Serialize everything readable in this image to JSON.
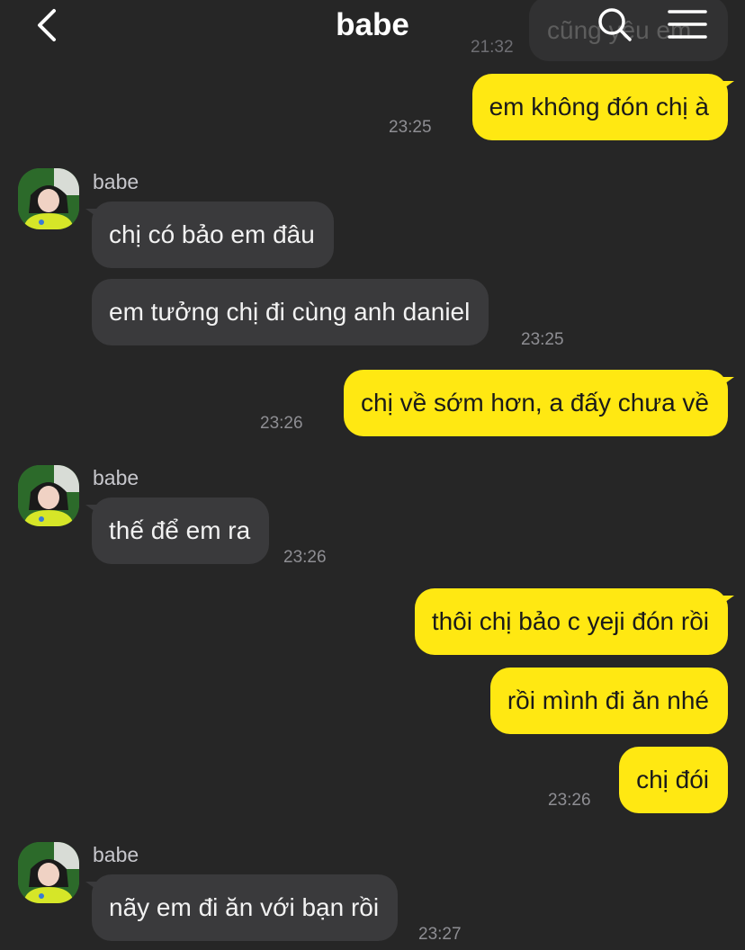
{
  "header": {
    "title": "babe",
    "back_icon": "chevron-left-icon",
    "search_icon": "search-icon",
    "menu_icon": "menu-icon",
    "partial_message": {
      "text": "cũng yêu em",
      "time": "21:32"
    }
  },
  "colors": {
    "background": "#262626",
    "incoming_bubble": "#3a3a3c",
    "outgoing_bubble": "#ffe812",
    "timestamp": "#8e8e93"
  },
  "messages": [
    {
      "side": "out",
      "text": "em không đón chị à",
      "time": "23:25"
    },
    {
      "side": "in",
      "sender": "babe",
      "texts": [
        "chị có bảo em đâu",
        "em tưởng chị đi cùng anh daniel"
      ],
      "time": "23:25"
    },
    {
      "side": "out",
      "text": "chị về sớm hơn, a đấy chưa về",
      "time": "23:26"
    },
    {
      "side": "in",
      "sender": "babe",
      "texts": [
        "thế để em ra"
      ],
      "time": "23:26"
    },
    {
      "side": "out",
      "texts": [
        "thôi chị bảo c yeji đón rồi",
        "rồi mình đi ăn nhé",
        "chị đói"
      ],
      "time": "23:26"
    },
    {
      "side": "in",
      "sender": "babe",
      "texts": [
        "nãy em đi ăn với bạn rồi"
      ],
      "time": "23:27"
    }
  ]
}
